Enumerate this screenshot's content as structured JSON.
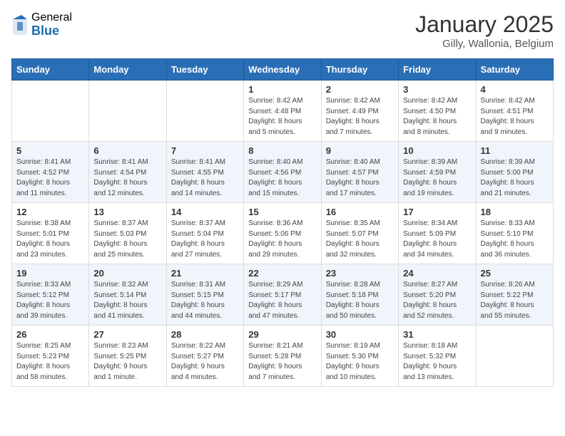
{
  "header": {
    "logo_general": "General",
    "logo_blue": "Blue",
    "month": "January 2025",
    "location": "Gilly, Wallonia, Belgium"
  },
  "days_of_week": [
    "Sunday",
    "Monday",
    "Tuesday",
    "Wednesday",
    "Thursday",
    "Friday",
    "Saturday"
  ],
  "weeks": [
    [
      {
        "day": "",
        "info": ""
      },
      {
        "day": "",
        "info": ""
      },
      {
        "day": "",
        "info": ""
      },
      {
        "day": "1",
        "info": "Sunrise: 8:42 AM\nSunset: 4:48 PM\nDaylight: 8 hours\nand 5 minutes."
      },
      {
        "day": "2",
        "info": "Sunrise: 8:42 AM\nSunset: 4:49 PM\nDaylight: 8 hours\nand 7 minutes."
      },
      {
        "day": "3",
        "info": "Sunrise: 8:42 AM\nSunset: 4:50 PM\nDaylight: 8 hours\nand 8 minutes."
      },
      {
        "day": "4",
        "info": "Sunrise: 8:42 AM\nSunset: 4:51 PM\nDaylight: 8 hours\nand 9 minutes."
      }
    ],
    [
      {
        "day": "5",
        "info": "Sunrise: 8:41 AM\nSunset: 4:52 PM\nDaylight: 8 hours\nand 11 minutes."
      },
      {
        "day": "6",
        "info": "Sunrise: 8:41 AM\nSunset: 4:54 PM\nDaylight: 8 hours\nand 12 minutes."
      },
      {
        "day": "7",
        "info": "Sunrise: 8:41 AM\nSunset: 4:55 PM\nDaylight: 8 hours\nand 14 minutes."
      },
      {
        "day": "8",
        "info": "Sunrise: 8:40 AM\nSunset: 4:56 PM\nDaylight: 8 hours\nand 15 minutes."
      },
      {
        "day": "9",
        "info": "Sunrise: 8:40 AM\nSunset: 4:57 PM\nDaylight: 8 hours\nand 17 minutes."
      },
      {
        "day": "10",
        "info": "Sunrise: 8:39 AM\nSunset: 4:59 PM\nDaylight: 8 hours\nand 19 minutes."
      },
      {
        "day": "11",
        "info": "Sunrise: 8:39 AM\nSunset: 5:00 PM\nDaylight: 8 hours\nand 21 minutes."
      }
    ],
    [
      {
        "day": "12",
        "info": "Sunrise: 8:38 AM\nSunset: 5:01 PM\nDaylight: 8 hours\nand 23 minutes."
      },
      {
        "day": "13",
        "info": "Sunrise: 8:37 AM\nSunset: 5:03 PM\nDaylight: 8 hours\nand 25 minutes."
      },
      {
        "day": "14",
        "info": "Sunrise: 8:37 AM\nSunset: 5:04 PM\nDaylight: 8 hours\nand 27 minutes."
      },
      {
        "day": "15",
        "info": "Sunrise: 8:36 AM\nSunset: 5:06 PM\nDaylight: 8 hours\nand 29 minutes."
      },
      {
        "day": "16",
        "info": "Sunrise: 8:35 AM\nSunset: 5:07 PM\nDaylight: 8 hours\nand 32 minutes."
      },
      {
        "day": "17",
        "info": "Sunrise: 8:34 AM\nSunset: 5:09 PM\nDaylight: 8 hours\nand 34 minutes."
      },
      {
        "day": "18",
        "info": "Sunrise: 8:33 AM\nSunset: 5:10 PM\nDaylight: 8 hours\nand 36 minutes."
      }
    ],
    [
      {
        "day": "19",
        "info": "Sunrise: 8:33 AM\nSunset: 5:12 PM\nDaylight: 8 hours\nand 39 minutes."
      },
      {
        "day": "20",
        "info": "Sunrise: 8:32 AM\nSunset: 5:14 PM\nDaylight: 8 hours\nand 41 minutes."
      },
      {
        "day": "21",
        "info": "Sunrise: 8:31 AM\nSunset: 5:15 PM\nDaylight: 8 hours\nand 44 minutes."
      },
      {
        "day": "22",
        "info": "Sunrise: 8:29 AM\nSunset: 5:17 PM\nDaylight: 8 hours\nand 47 minutes."
      },
      {
        "day": "23",
        "info": "Sunrise: 8:28 AM\nSunset: 5:18 PM\nDaylight: 8 hours\nand 50 minutes."
      },
      {
        "day": "24",
        "info": "Sunrise: 8:27 AM\nSunset: 5:20 PM\nDaylight: 8 hours\nand 52 minutes."
      },
      {
        "day": "25",
        "info": "Sunrise: 8:26 AM\nSunset: 5:22 PM\nDaylight: 8 hours\nand 55 minutes."
      }
    ],
    [
      {
        "day": "26",
        "info": "Sunrise: 8:25 AM\nSunset: 5:23 PM\nDaylight: 8 hours\nand 58 minutes."
      },
      {
        "day": "27",
        "info": "Sunrise: 8:23 AM\nSunset: 5:25 PM\nDaylight: 9 hours\nand 1 minute."
      },
      {
        "day": "28",
        "info": "Sunrise: 8:22 AM\nSunset: 5:27 PM\nDaylight: 9 hours\nand 4 minutes."
      },
      {
        "day": "29",
        "info": "Sunrise: 8:21 AM\nSunset: 5:28 PM\nDaylight: 9 hours\nand 7 minutes."
      },
      {
        "day": "30",
        "info": "Sunrise: 8:19 AM\nSunset: 5:30 PM\nDaylight: 9 hours\nand 10 minutes."
      },
      {
        "day": "31",
        "info": "Sunrise: 8:18 AM\nSunset: 5:32 PM\nDaylight: 9 hours\nand 13 minutes."
      },
      {
        "day": "",
        "info": ""
      }
    ]
  ]
}
